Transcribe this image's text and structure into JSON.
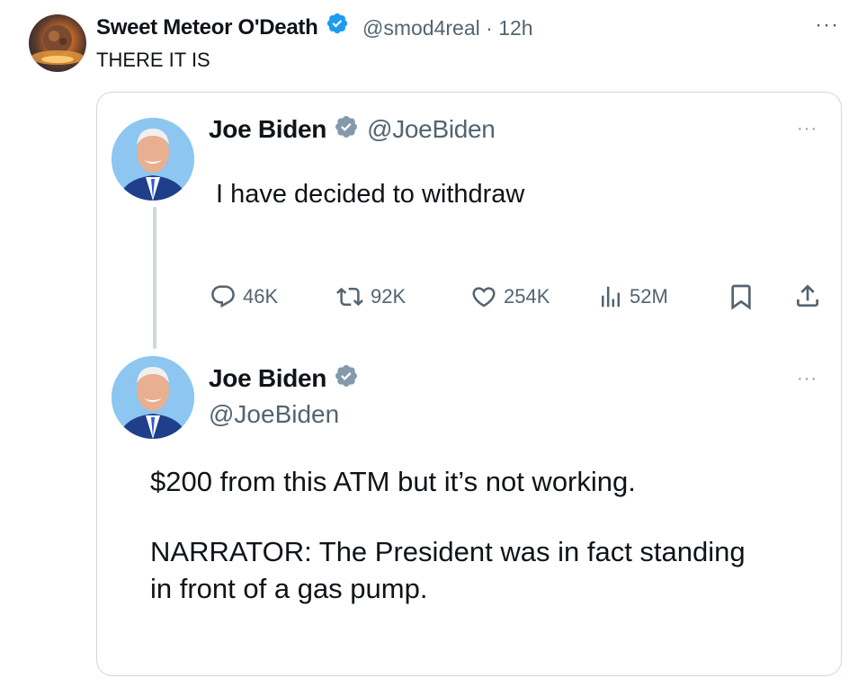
{
  "outer_tweet": {
    "display_name": "Sweet Meteor O'Death",
    "handle": "@smod4real",
    "separator": "·",
    "time": "12h",
    "more_label": "···",
    "text": "THERE IT IS"
  },
  "quoted": {
    "tweet1": {
      "display_name": "Joe Biden",
      "handle": "@JoeBiden",
      "more_label": "···",
      "text": "I have decided to withdraw",
      "actions": {
        "replies": "46K",
        "reposts": "92K",
        "likes": "254K",
        "views": "52M"
      }
    },
    "tweet2": {
      "display_name": "Joe Biden",
      "handle": "@JoeBiden",
      "more_label": "···",
      "line1": "$200 from this ATM but it’s not working.",
      "line2": "NARRATOR: The President was in fact standing",
      "line3": "in front of a gas pump."
    }
  },
  "icons": {
    "verified": "verified-badge-icon",
    "reply": "reply-icon",
    "repost": "repost-icon",
    "like": "heart-icon",
    "views": "views-icon",
    "bookmark": "bookmark-icon",
    "share": "share-icon"
  },
  "colors": {
    "verified_blue": "#1d9bf0",
    "verified_gray": "#829aab",
    "secondary_text": "#536471",
    "border": "#cfd9de"
  }
}
